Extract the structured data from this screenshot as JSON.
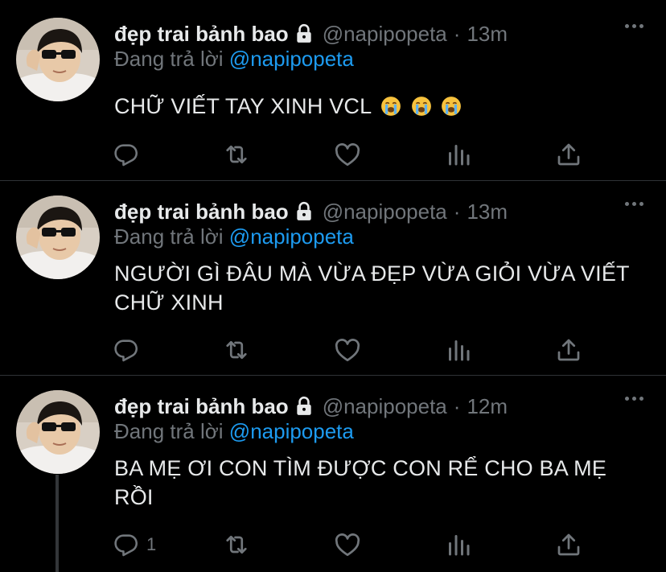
{
  "tweets": [
    {
      "display_name": "đẹp trai bảnh bao",
      "handle": "@napipopeta",
      "separator": "·",
      "time": "13m",
      "replying_prefix": "Đang trả lời",
      "replying_to": "@napipopeta",
      "text": "CHỮ VIẾT TAY XINH VCL",
      "emojis": [
        "loudly-crying-face",
        "loudly-crying-face",
        "loudly-crying-face"
      ],
      "reply_count": ""
    },
    {
      "display_name": "đẹp trai bảnh bao",
      "handle": "@napipopeta",
      "separator": "·",
      "time": "13m",
      "replying_prefix": "Đang trả lời",
      "replying_to": "@napipopeta",
      "text": "NGƯỜI GÌ ĐÂU MÀ VỪA ĐẸP VỪA GIỎI VỪA VIẾT CHỮ XINH",
      "reply_count": ""
    },
    {
      "display_name": "đẹp trai bảnh bao",
      "handle": "@napipopeta",
      "separator": "·",
      "time": "12m",
      "replying_prefix": "Đang trả lời",
      "replying_to": "@napipopeta",
      "text": "BA MẸ ƠI CON TÌM ĐƯỢC CON RỂ CHO BA MẸ RỒI",
      "reply_count": "1"
    }
  ],
  "icons": [
    "lock-icon",
    "more-icon",
    "reply-icon",
    "retweet-icon",
    "like-icon",
    "analytics-icon",
    "share-icon"
  ],
  "colors": {
    "background": "#000000",
    "primary_text": "#e7e9ea",
    "secondary_text": "#71767b",
    "mention": "#1d9bf0",
    "divider": "#2f3336"
  }
}
